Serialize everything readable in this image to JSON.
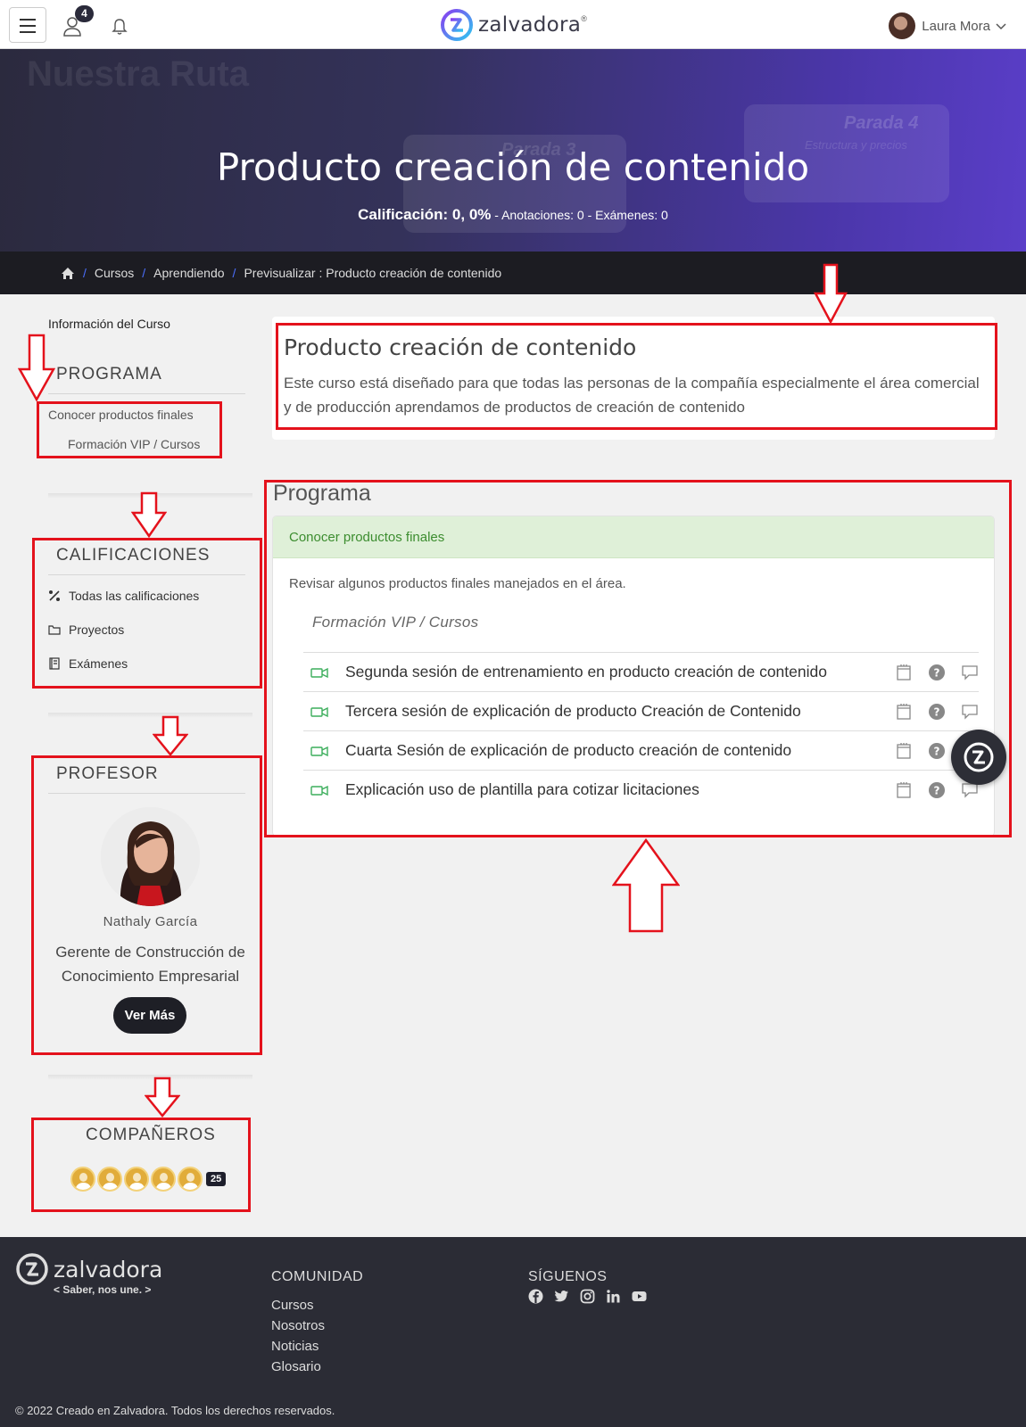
{
  "header": {
    "notification_count": "4",
    "logo_text": "zalvadora",
    "logo_mark": "®",
    "user_name": "Laura Mora"
  },
  "banner": {
    "title": "Producto creación de contenido",
    "rating_label": "Calificación: 0, 0%",
    "rest_text": " - Anotaciones: 0 - Exámenes: 0",
    "bg_words": {
      "ruta": "Nuestra Ruta",
      "parada3": "Parada 3",
      "parada4": "Parada 4",
      "estructura": "Estructura y precios"
    }
  },
  "breadcrumb": [
    "Cursos",
    "Aprendiendo",
    "Previsualizar : Producto creación de contenido"
  ],
  "sidebar": {
    "info_link": "Información del Curso",
    "programa": {
      "title": "PROGRAMA",
      "items": [
        "Conocer productos finales",
        "Formación VIP / Cursos"
      ]
    },
    "calificaciones": {
      "title": "CALIFICACIONES",
      "items": [
        "Todas las calificaciones",
        "Proyectos",
        "Exámenes"
      ]
    },
    "profesor": {
      "title": "PROFESOR",
      "name": "Nathaly García",
      "role": "Gerente de Construcción de Conocimiento Empresarial",
      "button": "Ver Más"
    },
    "companeros": {
      "title": "COMPAÑEROS",
      "count": "25"
    }
  },
  "course": {
    "title": "Producto creación de contenido",
    "description": "Este curso está diseñado para que todas las personas de la compañía especialmente el área comercial y de producción aprendamos de productos de creación de contenido"
  },
  "program": {
    "heading": "Programa",
    "section_title": "Conocer productos finales",
    "section_desc": "Revisar algunos productos finales manejados en el área.",
    "subsection": "Formación VIP / Cursos",
    "lessons": [
      "Segunda sesión de entrenamiento en producto creación de contenido",
      "Tercera sesión de explicación de producto Creación de Contenido",
      "Cuarta Sesión de explicación de producto creación de contenido",
      "Explicación uso de plantilla para cotizar licitaciones"
    ]
  },
  "footer": {
    "logo_text": "zalvadora",
    "slogan": "< Saber, nos une. >",
    "community_title": "COMUNIDAD",
    "links": [
      "Cursos",
      "Nosotros",
      "Noticias",
      "Glosario"
    ],
    "follow_title": "SÍGUENOS",
    "social_icons": [
      "facebook-icon",
      "twitter-icon",
      "instagram-icon",
      "linkedin-icon",
      "youtube-icon"
    ],
    "copyright": "© 2022 Creado en Zalvadora. Todos los derechos reservados."
  },
  "colors": {
    "accent": "#4b6fff",
    "annotation_red": "#e4121c",
    "success_bg": "#dff0d8",
    "dark": "#1e1f26"
  }
}
